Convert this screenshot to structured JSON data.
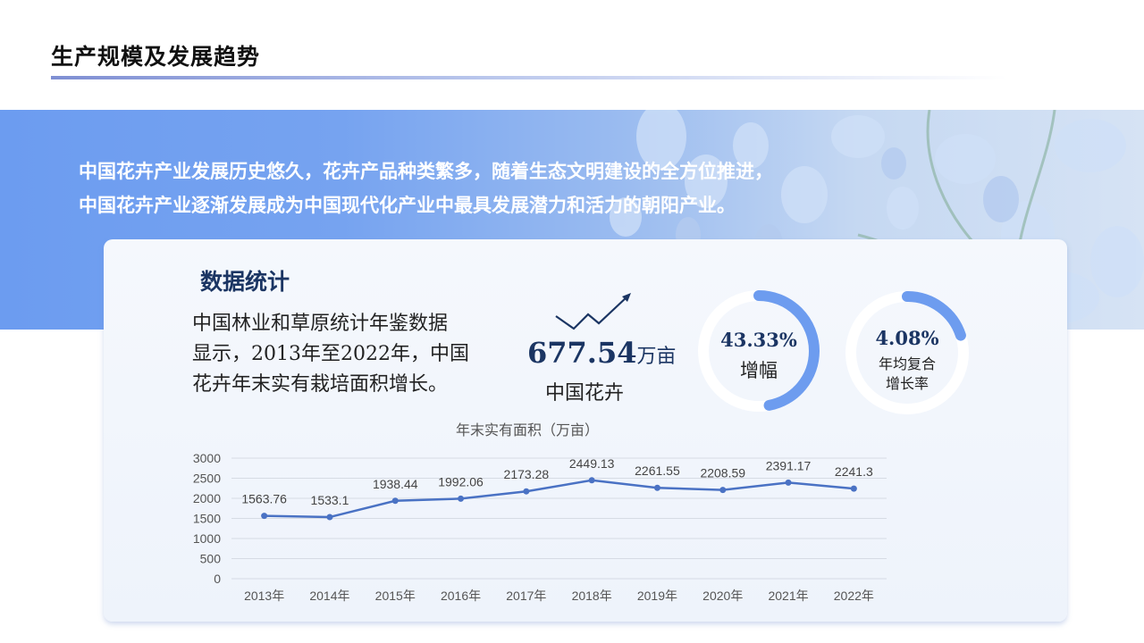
{
  "page": {
    "title": "生产规模及发展趋势"
  },
  "intro": {
    "line1": "中国花卉产业发展历史悠久，花卉产品种类繁多，随着生态文明建设的全方位推进，",
    "line2": "中国花卉产业逐渐发展成为中国现代化产业中最具发展潜力和活力的朝阳产业。"
  },
  "stats": {
    "title": "数据统计",
    "desc_lines": [
      "中国林业和草原统计年鉴数据",
      "显示，2013年至2022年，中国",
      "花卉年末实有栽培面积增长。"
    ],
    "area_value": "677.54",
    "area_unit": "万亩",
    "area_label": "中国花卉",
    "growth_value": "43.33%",
    "growth_label": "增幅",
    "growth_fraction": 0.4333,
    "cagr_value": "4.08%",
    "cagr_label_1": "年均复合",
    "cagr_label_2": "增长率",
    "cagr_fraction": 0.2,
    "accent_color": "#6d9cef",
    "ring_track_color": "#ffffff"
  },
  "chart_data": {
    "type": "line",
    "title": "年末实有面积（万亩）",
    "categories": [
      "2013年",
      "2014年",
      "2015年",
      "2016年",
      "2017年",
      "2018年",
      "2019年",
      "2020年",
      "2021年",
      "2022年"
    ],
    "values": [
      1563.76,
      1533.1,
      1938.44,
      1992.06,
      2173.28,
      2449.13,
      2261.55,
      2208.59,
      2391.17,
      2241.3
    ],
    "labels": [
      "1563.76",
      "1533.1",
      "1938.44",
      "1992.06",
      "2173.28",
      "2449.13",
      "2261.55",
      "2208.59",
      "2391.17",
      "2241.3"
    ],
    "y_ticks": [
      0,
      500,
      1000,
      1500,
      2000,
      2500,
      3000
    ],
    "ylim": [
      0,
      3000
    ],
    "grid": true,
    "line_color": "#4a72c4"
  }
}
